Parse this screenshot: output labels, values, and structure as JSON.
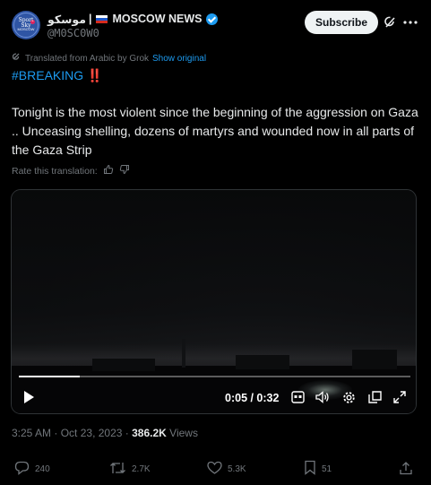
{
  "header": {
    "display_name_ar": "موسكو",
    "separator": "|",
    "display_name_en": "MOSCOW NEWS",
    "handle": "@M0SC0W0",
    "avatar_text_top": "Sport Sky",
    "avatar_text_bottom": "MOSCOW",
    "subscribe_label": "Subscribe",
    "icons": [
      "grok-icon",
      "more-icon",
      "verified-badge-icon",
      "russia-flag-icon"
    ]
  },
  "translation": {
    "note": "Translated from Arabic by Grok",
    "show_original": "Show original",
    "rate_label": "Rate this translation:"
  },
  "post": {
    "hashtag": "#BREAKING",
    "hashtag_emoji": "‼️",
    "text": "Tonight is the most violent since the beginning of the aggression on Gaza .. Unceasing shelling, dozens of martyrs and wounded now in all parts of the Gaza Strip"
  },
  "video": {
    "time": "0:05 / 0:32",
    "progress_fraction": 0.156,
    "icons": [
      "play-icon",
      "captions-icon",
      "volume-icon",
      "settings-icon",
      "pip-icon",
      "fullscreen-icon"
    ]
  },
  "meta": {
    "time": "3:25 AM",
    "sep1": "·",
    "date": "Oct 23, 2023",
    "sep2": "·",
    "views": "386.2K",
    "views_label": "Views"
  },
  "actions": {
    "replies": "240",
    "reposts": "2.7K",
    "likes": "5.3K",
    "bookmarks": "51"
  },
  "colors": {
    "background": "#000000",
    "accent": "#1d9bf0",
    "muted": "#71767b",
    "text": "#e7e9ea"
  }
}
